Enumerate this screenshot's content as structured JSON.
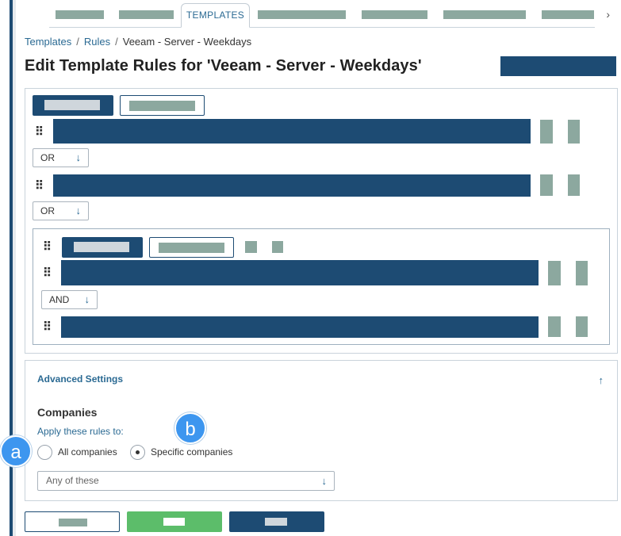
{
  "tabs": {
    "active_label": "TEMPLATES",
    "next_icon": "chevron-right-icon",
    "next_glyph": "›"
  },
  "breadcrumb": {
    "items": [
      "Templates",
      "Rules",
      "Veeam - Server - Weekdays"
    ],
    "separator": "/"
  },
  "page": {
    "title": "Edit Template Rules for 'Veeam - Server - Weekdays'"
  },
  "rules": {
    "operators": [
      "OR",
      "OR",
      "AND"
    ],
    "drag_glyph": "⠿",
    "arrow_glyph": "↓"
  },
  "advanced": {
    "title": "Advanced Settings",
    "toggle_glyph": "↑",
    "companies_heading": "Companies",
    "apply_label": "Apply these rules to:",
    "radio_options": [
      "All companies",
      "Specific companies"
    ],
    "selected_option": "Specific companies",
    "dropdown_value": "Any of these",
    "dropdown_arrow": "↓"
  },
  "markers": [
    "a",
    "b"
  ],
  "colors": {
    "primary": "#1d4b73",
    "link": "#2b6a93",
    "placeholder": "#8ca89f",
    "success": "#5cbd6a",
    "marker": "#3d96ef"
  }
}
